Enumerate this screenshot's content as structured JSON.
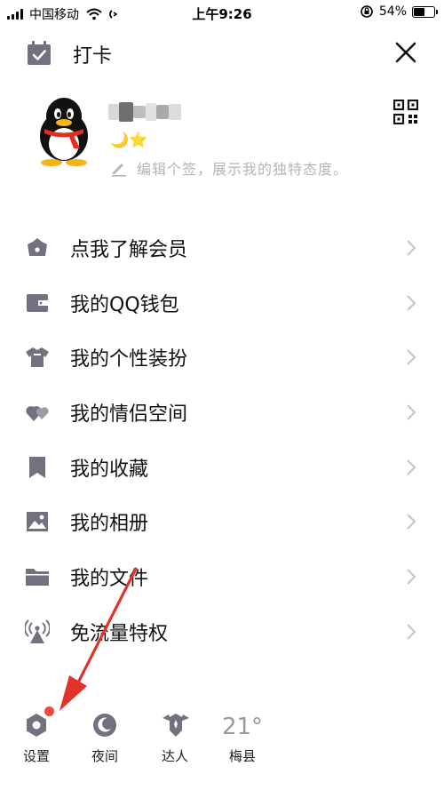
{
  "status_bar": {
    "carrier": "中国移动",
    "time": "上午9:26",
    "battery_text": "54%",
    "battery_level": 54
  },
  "header": {
    "title": "打卡"
  },
  "profile": {
    "badges": "🌙⭐",
    "signature_placeholder": "编辑个签，展示我的独特态度。"
  },
  "menu": {
    "items": [
      {
        "label": "点我了解会员",
        "icon": "crown-icon"
      },
      {
        "label": "我的QQ钱包",
        "icon": "wallet-icon"
      },
      {
        "label": "我的个性装扮",
        "icon": "tshirt-icon"
      },
      {
        "label": "我的情侣空间",
        "icon": "hearts-icon"
      },
      {
        "label": "我的收藏",
        "icon": "bookmark-icon"
      },
      {
        "label": "我的相册",
        "icon": "photo-icon"
      },
      {
        "label": "我的文件",
        "icon": "folder-icon"
      },
      {
        "label": "免流量特权",
        "icon": "antenna-icon"
      }
    ]
  },
  "bottom_bar": {
    "settings_label": "设置",
    "night_label": "夜间",
    "expert_label": "达人",
    "temperature": "21°",
    "city": "梅县"
  },
  "colors": {
    "icon_gray": "#71717f",
    "text_primary": "#111111",
    "placeholder": "#b4b4bc",
    "chevron": "#c4c4c8",
    "badge_red": "#f0473f",
    "annotation_red": "#e2322a"
  }
}
